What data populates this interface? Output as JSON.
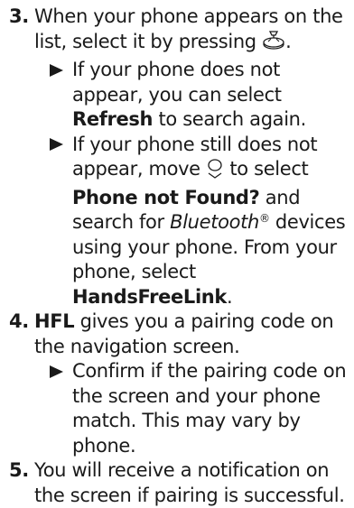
{
  "colors": {
    "text": "#1a1a1a",
    "arrow": "#1a1a1a"
  },
  "icons": {
    "select_button": "enter-dial-icon",
    "interface_dial": "interface-dial-down-icon",
    "bullet": "triangle-right-icon"
  },
  "steps": [
    {
      "number": "3.",
      "text": "When your phone appears on the list, select it by pressing",
      "text_end": ".",
      "subs": [
        {
          "t1": "If your phone does not appear, you can select ",
          "bold1": "Refresh",
          "t2": " to search again."
        },
        {
          "t1": "If your phone still does not appear, move ",
          "t2": " to select ",
          "bold1": "Phone not Found?",
          "t3": " and search for ",
          "italic1": "Bluetooth",
          "reg": "®",
          "t4": " devices using your phone. From your phone, select ",
          "bold2": "HandsFreeLink",
          "t5": "."
        }
      ]
    },
    {
      "number": "4.",
      "bold": "HFL",
      "text": " gives you a pairing code on the navigation screen.",
      "subs": [
        {
          "t1": "Confirm if the pairing code on the screen and your phone match. This may vary by phone."
        }
      ]
    },
    {
      "number": "5.",
      "text": "You will receive a notification on the screen if pairing is successful."
    }
  ]
}
